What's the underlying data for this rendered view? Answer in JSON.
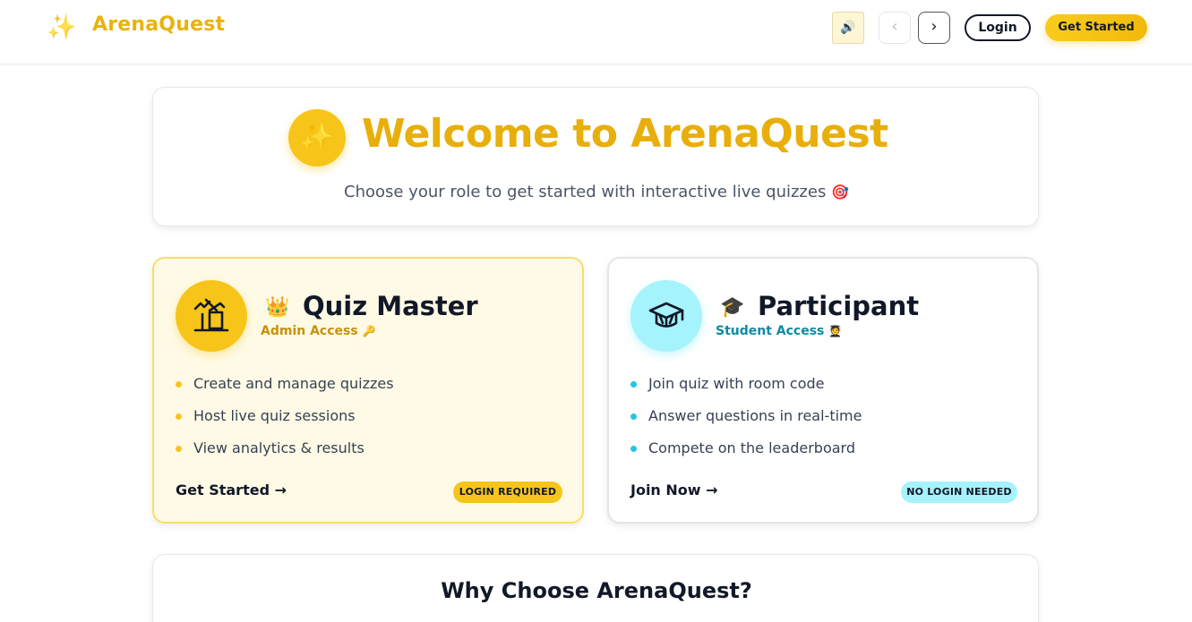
{
  "header": {
    "logo_icon": "sparkles-icon",
    "logo_text": "ArenaQuest",
    "sound_icon": "speaker-icon",
    "prev_icon": "chevron-left-icon",
    "next_icon": "chevron-right-icon",
    "login_label": "Login",
    "get_started_label": "Get Started"
  },
  "welcome": {
    "badge_icon": "sparkles-icon",
    "title": "Welcome to ArenaQuest",
    "subtitle": "Choose your role to get started with interactive live quizzes",
    "subtitle_emoji": "🎯"
  },
  "roles": [
    {
      "icon": "construction-icon",
      "emoji": "👑",
      "title": "Quiz Master",
      "access": "Admin Access",
      "access_emoji": "🔑",
      "features": [
        "Create and manage quizzes",
        "Host live quiz sessions",
        "View analytics & results"
      ],
      "cta": "Get Started →",
      "pill": "LOGIN REQUIRED"
    },
    {
      "icon": "graduation-cap-icon",
      "emoji": "🎓",
      "title": "Participant",
      "access": "Student Access",
      "access_emoji": "🧑‍🎓",
      "features": [
        "Join quiz with room code",
        "Answer questions in real-time",
        "Compete on the leaderboard"
      ],
      "cta": "Join Now →",
      "pill": "NO LOGIN NEEDED"
    }
  ],
  "why": {
    "title": "Why Choose ArenaQuest?"
  },
  "colors": {
    "brand": "#F2B90B",
    "accent_cyan": "#A5F3FC",
    "text_dark": "#111827"
  }
}
